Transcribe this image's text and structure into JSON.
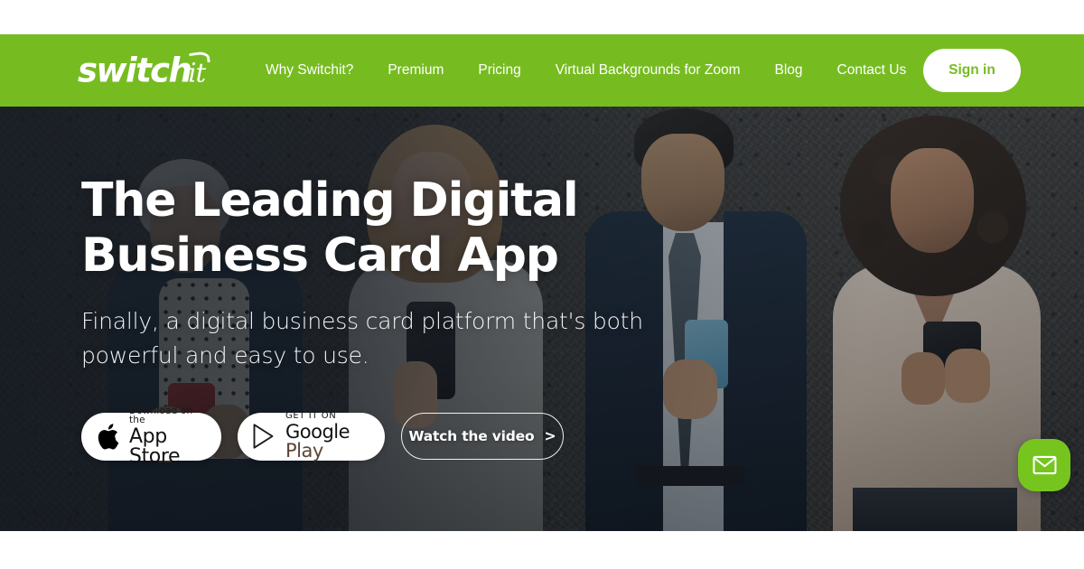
{
  "brand": {
    "name": "switchit",
    "logo_main": "switch",
    "logo_script": "it",
    "green": "#76bc21",
    "logo_icon": "switchit-wordmark"
  },
  "nav": {
    "items": [
      {
        "label": "Why Switchit?",
        "name": "nav-why-switchit"
      },
      {
        "label": "Premium",
        "name": "nav-premium"
      },
      {
        "label": "Pricing",
        "name": "nav-pricing"
      },
      {
        "label": "Virtual Backgrounds for Zoom",
        "name": "nav-virtual-backgrounds"
      },
      {
        "label": "Blog",
        "name": "nav-blog"
      },
      {
        "label": "Contact Us",
        "name": "nav-contact-us"
      }
    ],
    "signin_label": "Sign in"
  },
  "hero": {
    "title_line1": "The Leading Digital",
    "title_line2": "Business Card App",
    "sub_line1": "Finally, a digital business card platform that's both",
    "sub_line2": "powerful and easy to use.",
    "appstore": {
      "small": "Download on the",
      "big": "App Store",
      "icon": "apple-icon"
    },
    "googleplay": {
      "small": "GET IT ON",
      "big_first": "Google",
      "big_second": " Play",
      "icon": "google-play-icon"
    },
    "watch_label": "Watch the video",
    "watch_arrow": ">"
  },
  "chat": {
    "icon": "envelope-icon",
    "color": "#76c51f"
  }
}
